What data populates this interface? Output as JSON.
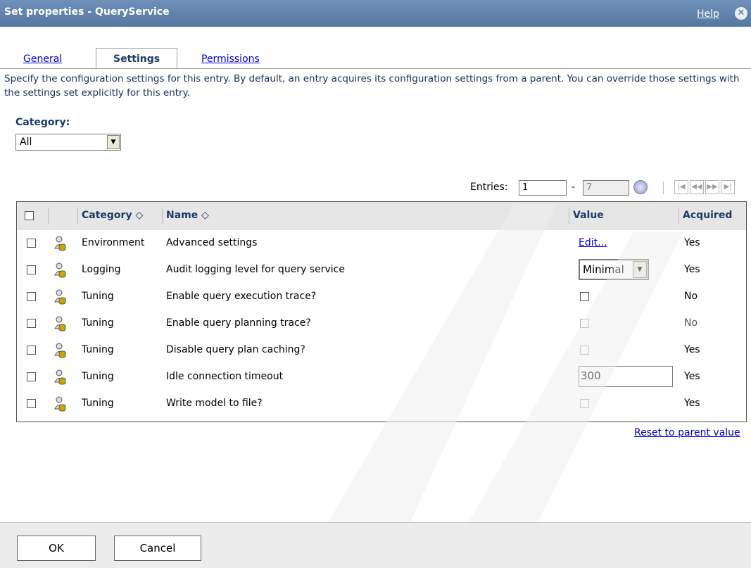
{
  "window": {
    "title": "Set properties - QueryService",
    "help_label": "Help",
    "close_icon": "close-icon"
  },
  "tabs": [
    {
      "label": "General",
      "active": false
    },
    {
      "label": "Settings",
      "active": true
    },
    {
      "label": "Permissions",
      "active": false
    }
  ],
  "description": "Specify the configuration settings for this entry. By default, an entry acquires its configuration settings from a parent. You can override those settings with the settings set explicitly for this entry.",
  "category_filter": {
    "label": "Category:",
    "selected": "All"
  },
  "entries": {
    "label": "Entries:",
    "from": "1",
    "dash": "-",
    "to": "7"
  },
  "table": {
    "headers": {
      "category": "Category ◇",
      "name": "Name ◇",
      "value": "Value",
      "acquired": "Acquired"
    },
    "rows": [
      {
        "category": "Environment",
        "name": "Advanced settings",
        "value_type": "link",
        "value": "Edit...",
        "acquired": "Yes"
      },
      {
        "category": "Logging",
        "name": "Audit logging level for query service",
        "value_type": "select",
        "value": "Minimal",
        "acquired": "Yes"
      },
      {
        "category": "Tuning",
        "name": "Enable query execution trace?",
        "value_type": "checkbox",
        "value": "",
        "acquired": "No"
      },
      {
        "category": "Tuning",
        "name": "Enable query planning trace?",
        "value_type": "checkbox",
        "value": "",
        "acquired": "No"
      },
      {
        "category": "Tuning",
        "name": "Disable query plan caching?",
        "value_type": "checkbox",
        "value": "",
        "acquired": "Yes"
      },
      {
        "category": "Tuning",
        "name": "Idle connection timeout",
        "value_type": "input",
        "value": "300",
        "acquired": "Yes"
      },
      {
        "category": "Tuning",
        "name": "Write model to file?",
        "value_type": "checkbox",
        "value": "",
        "acquired": "Yes"
      }
    ]
  },
  "reset_label": "Reset to parent value",
  "footer": {
    "ok_label": "OK",
    "cancel_label": "Cancel"
  },
  "colors": {
    "titlebar": "#6f90ba",
    "link": "#0000cc",
    "header_bg": "#e6e6e6"
  }
}
